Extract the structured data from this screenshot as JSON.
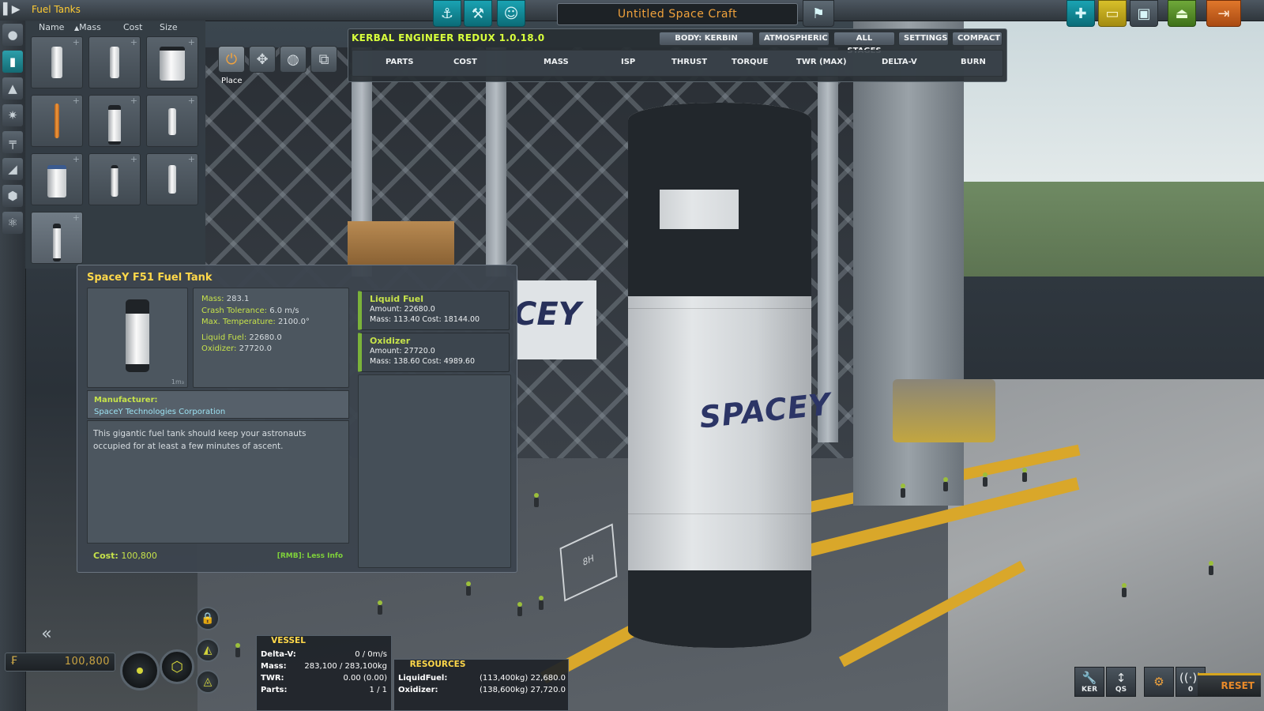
{
  "topbar": {
    "category_title": "Fuel Tanks",
    "craft_name": "Untitled Space Craft",
    "tools_left": [
      {
        "icon": "crane-icon"
      },
      {
        "icon": "wrench-icon"
      },
      {
        "icon": "kerbal-crew-icon"
      }
    ],
    "flag_tool": {
      "icon": "flag-icon"
    },
    "tools_right": [
      {
        "icon": "new-craft-icon",
        "color": "#1aa3b3"
      },
      {
        "icon": "open-folder-icon",
        "color": "#d8c02a"
      },
      {
        "icon": "save-icon",
        "color": "#5e6a74"
      },
      {
        "icon": "launch-pad-icon",
        "color": "#6fa83a"
      },
      {
        "icon": "exit-icon",
        "color": "#e0772b"
      }
    ]
  },
  "category_bar": {
    "items": [
      {
        "icon": "pods-icon",
        "active": false
      },
      {
        "icon": "fuel-tanks-icon",
        "active": true
      },
      {
        "icon": "engines-icon",
        "active": false
      },
      {
        "icon": "control-icon",
        "active": false
      },
      {
        "icon": "structural-icon",
        "active": false
      },
      {
        "icon": "aerodynamics-icon",
        "active": false
      },
      {
        "icon": "utility-icon",
        "active": false
      },
      {
        "icon": "science-icon",
        "active": false
      }
    ]
  },
  "parts_list": {
    "sort_headers": [
      "Name",
      "Mass",
      "Cost",
      "Size"
    ],
    "sort_active": "Mass",
    "sort_arrow": "▲",
    "parts": [
      {
        "name": "tank-1",
        "style": "slim"
      },
      {
        "name": "tank-2",
        "style": "slim"
      },
      {
        "name": "tank-3",
        "style": "wide"
      },
      {
        "name": "tank-4",
        "style": "orange"
      },
      {
        "name": "tank-5",
        "style": "dark-top"
      },
      {
        "name": "tank-6",
        "style": "small"
      },
      {
        "name": "tank-7",
        "style": "wide"
      },
      {
        "name": "tank-8",
        "style": "small"
      },
      {
        "name": "tank-9",
        "style": "small"
      },
      {
        "name": "tank-10",
        "style": "dark-top",
        "selected": true
      }
    ]
  },
  "build_tools": {
    "items": [
      {
        "icon": "place-icon",
        "active": true
      },
      {
        "icon": "offset-icon",
        "active": false
      },
      {
        "icon": "rotate-icon",
        "active": false
      },
      {
        "icon": "reroot-icon",
        "active": false
      }
    ],
    "active_caption": "Place"
  },
  "ker": {
    "title": "KERBAL ENGINEER REDUX 1.0.18.0",
    "tabs": [
      "BODY: KERBIN",
      "ATMOSPHERIC",
      "ALL STAGES",
      "SETTINGS",
      "COMPACT"
    ],
    "columns": [
      "PARTS",
      "COST",
      "MASS",
      "ISP",
      "THRUST",
      "TORQUE",
      "TWR (MAX)",
      "DELTA-V",
      "BURN"
    ]
  },
  "part_info": {
    "title": "SpaceY F51 Fuel Tank",
    "size_label": "1m₃",
    "stats": [
      {
        "key": "Mass:",
        "value": "283.1"
      },
      {
        "key": "Crash Tolerance:",
        "value": "6.0 m/s"
      },
      {
        "key": "Max. Temperature:",
        "value": "2100.0°"
      },
      {
        "key": "Liquid Fuel:",
        "value": "22680.0"
      },
      {
        "key": "Oxidizer:",
        "value": "27720.0"
      }
    ],
    "resources": [
      {
        "name": "Liquid Fuel",
        "amount": "Amount: 22680.0",
        "mass_cost": "Mass: 113.40 Cost: 18144.00"
      },
      {
        "name": "Oxidizer",
        "amount": "Amount: 27720.0",
        "mass_cost": "Mass: 138.60 Cost: 4989.60"
      }
    ],
    "manufacturer_label": "Manufacturer:",
    "manufacturer": "SpaceY Technologies Corporation",
    "description": "This gigantic fuel tank should keep your astronauts occupied for at least a few minutes of ascent.",
    "cost_label": "Cost:",
    "cost": "100,800",
    "less_info": "[RMB]: Less Info"
  },
  "scene": {
    "tank_logo": "SPACEY",
    "banner_text": "CEY",
    "pad_marking": "8H"
  },
  "bottom_left": {
    "back_icon": "double-chevron-left-icon",
    "funds": "100,800",
    "symmetry_icons": [
      "lock-icon",
      "angle-snap-icon",
      "symmetry-icon"
    ]
  },
  "vessel": {
    "title": "VESSEL",
    "rows": [
      {
        "key": "Delta-V:",
        "value": "0 / 0m/s"
      },
      {
        "key": "Mass:",
        "value": "283,100 / 283,100kg"
      },
      {
        "key": "TWR:",
        "value": "0.00 (0.00)"
      },
      {
        "key": "Parts:",
        "value": "1 / 1"
      }
    ]
  },
  "resources_panel": {
    "title": "RESOURCES",
    "rows": [
      {
        "key": "LiquidFuel:",
        "value": "(113,400kg) 22,680.0"
      },
      {
        "key": "Oxidizer:",
        "value": "(138,600kg) 27,720.0"
      }
    ]
  },
  "bottom_right": {
    "buttons": [
      {
        "icon": "wrench-icon",
        "caption": "KER"
      },
      {
        "icon": "quicksave-arrows-icon",
        "caption": "QS"
      },
      {
        "icon": "settings-gear-icon",
        "caption": ""
      },
      {
        "icon": "comm-signal-icon",
        "caption": "0"
      }
    ],
    "reset_label": "RESET"
  }
}
